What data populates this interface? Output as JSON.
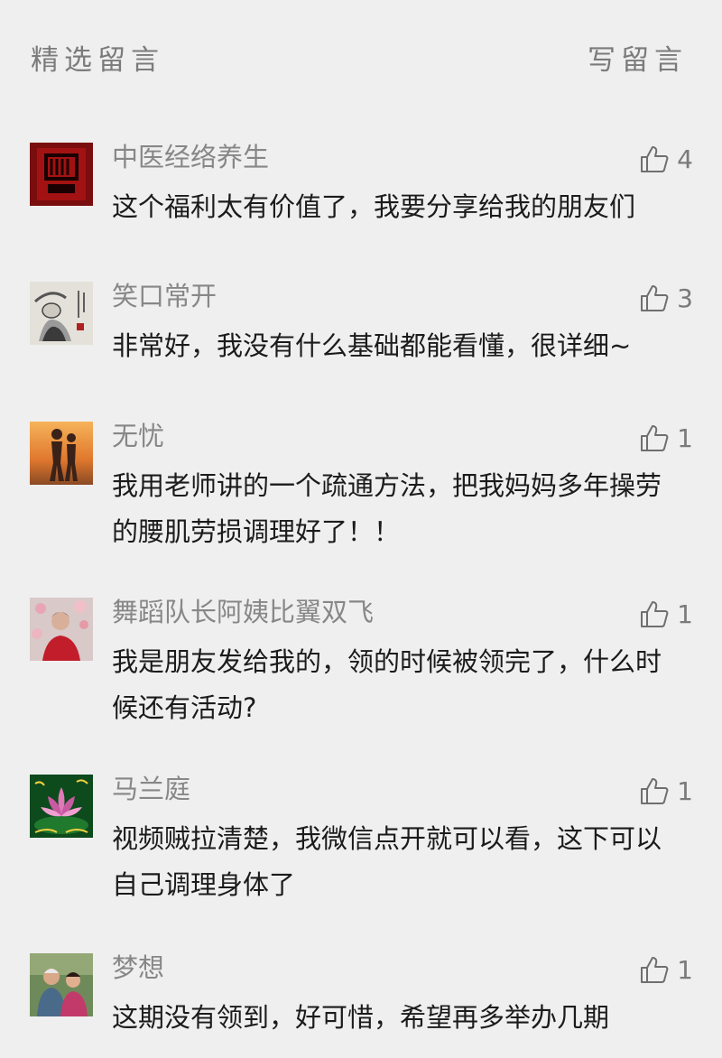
{
  "header": {
    "title": "精选留言",
    "write_label": "写留言"
  },
  "comments": [
    {
      "nickname": "中医经络养生",
      "text": "这个福利太有价值了，我要分享给我的朋友们",
      "likes": "4",
      "avatar_icon": "red-seal-avatar"
    },
    {
      "nickname": "笑口常开",
      "text": "非常好，我没有什么基础都能看懂，很详细~",
      "likes": "3",
      "avatar_icon": "ink-painting-avatar"
    },
    {
      "nickname": "无忧",
      "text": "我用老师讲的一个疏通方法，把我妈妈多年操劳的腰肌劳损调理好了！！",
      "likes": "1",
      "avatar_icon": "sunset-couple-avatar"
    },
    {
      "nickname": "舞蹈队长阿姨比翼双飞",
      "text": "我是朋友发给我的，领的时候被领完了，什么时候还有活动?",
      "likes": "1",
      "avatar_icon": "woman-flowers-avatar"
    },
    {
      "nickname": "马兰庭",
      "text": "视频贼拉清楚，我微信点开就可以看，这下可以自己调理身体了",
      "likes": "1",
      "avatar_icon": "lotus-avatar"
    },
    {
      "nickname": "梦想",
      "text": "这期没有领到，好可惜，希望再多举办几期",
      "likes": "1",
      "avatar_icon": "elderly-couple-avatar"
    }
  ],
  "colors": {
    "background": "#efefef",
    "nickname": "#878787",
    "text": "#1b1b1b"
  }
}
